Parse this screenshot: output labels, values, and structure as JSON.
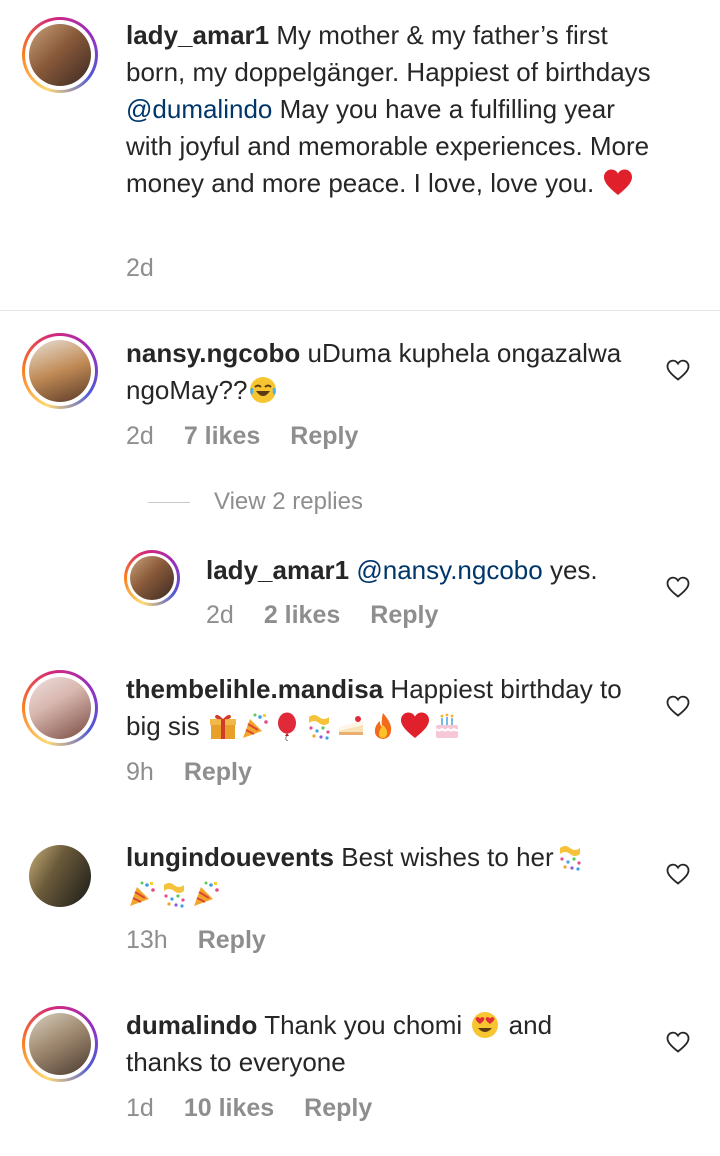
{
  "comments": [
    {
      "username": "lady_amar1",
      "text_before": "My mother & my father’s first born, my doppelgänger. Happiest of birthdays ",
      "mention": "@dumalindo",
      "text_after": " May you have a fulfilling year with joyful and memorable experiences. More money and more peace. I love, love you. ",
      "time": "2d"
    },
    {
      "username": "nansy.ngcobo",
      "text": "uDuma kuphela ongazalwa ngoMay??",
      "time": "2d",
      "likes": "7 likes",
      "reply_label": "Reply",
      "view_replies": "View 2 replies"
    },
    {
      "username": "lady_amar1",
      "mention": "@nansy.ngcobo",
      "text_after": " yes.",
      "time": "2d",
      "likes": "2 likes",
      "reply_label": "Reply"
    },
    {
      "username": "thembelihle.mandisa",
      "text": "Happiest birthday to big sis",
      "time": "9h",
      "reply_label": "Reply"
    },
    {
      "username": "lungindouevents",
      "text": "Best wishes to her",
      "time": "13h",
      "reply_label": "Reply"
    },
    {
      "username": "dumalindo",
      "text_before": "Thank you chomi",
      "text_after": " and thanks to everyone",
      "time": "1d",
      "likes": "10 likes",
      "reply_label": "Reply"
    }
  ],
  "icons": {
    "like": "heart-outline-icon"
  },
  "colors": {
    "mention": "#00376b",
    "meta": "#8e8e8e",
    "text": "#262626"
  }
}
